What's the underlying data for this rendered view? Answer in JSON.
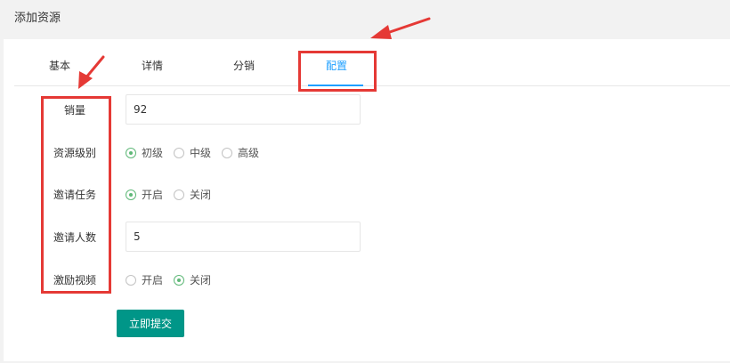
{
  "page": {
    "title": "添加资源"
  },
  "tabs": [
    {
      "label": "基本",
      "active": false
    },
    {
      "label": "详情",
      "active": false
    },
    {
      "label": "分销",
      "active": false
    },
    {
      "label": "配置",
      "active": true
    }
  ],
  "form": {
    "sales": {
      "label": "销量",
      "value": "92"
    },
    "level": {
      "label": "资源级别",
      "options": [
        {
          "label": "初级",
          "checked": true
        },
        {
          "label": "中级",
          "checked": false
        },
        {
          "label": "高级",
          "checked": false
        }
      ]
    },
    "invite_task": {
      "label": "邀请任务",
      "options": [
        {
          "label": "开启",
          "checked": true
        },
        {
          "label": "关闭",
          "checked": false
        }
      ]
    },
    "invite_count": {
      "label": "邀请人数",
      "value": "5"
    },
    "reward_video": {
      "label": "激励视频",
      "options": [
        {
          "label": "开启",
          "checked": false
        },
        {
          "label": "关闭",
          "checked": true
        }
      ]
    },
    "submit_label": "立即提交"
  },
  "colors": {
    "accent": "#1e9fff",
    "radio_checked": "#5fb878",
    "submit_bg": "#009688",
    "annotation": "#e53935"
  }
}
